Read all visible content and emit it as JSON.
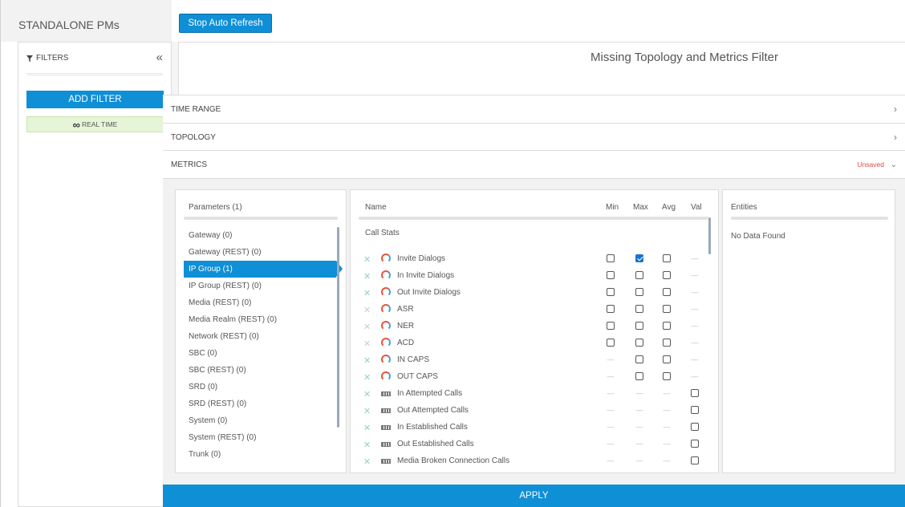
{
  "header": {
    "title": "STANDALONE PMs",
    "stop_refresh_label": "Stop Auto Refresh"
  },
  "filters": {
    "title": "FILTERS",
    "collapse_glyph": "«",
    "add_filter_label": "ADD FILTER",
    "realtime_label": "REAL TIME"
  },
  "main": {
    "missing_title": "Missing Topology and Metrics Filter",
    "sections": {
      "time_range": "TIME RANGE",
      "topology": "TOPOLOGY",
      "metrics": "METRICS",
      "unsaved": "Unsaved"
    },
    "apply_label": "APPLY"
  },
  "parameters": {
    "header": "Parameters (1)",
    "items": [
      "Gateway (0)",
      "Gateway (REST) (0)",
      "IP Group (1)",
      "IP Group (REST) (0)",
      "Media (REST) (0)",
      "Media Realm (REST) (0)",
      "Network (REST) (0)",
      "SBC (0)",
      "SBC (REST) (0)",
      "SRD (0)",
      "SRD (REST) (0)",
      "System (0)",
      "System (REST) (0)",
      "Trunk (0)"
    ],
    "selected": "IP Group (1)"
  },
  "metrics": {
    "columns": {
      "name": "Name",
      "min": "Min",
      "max": "Max",
      "avg": "Avg",
      "val": "Val"
    },
    "group": "Call Stats",
    "rows": [
      {
        "label": "Invite Dialogs",
        "icon": "gauge-icon",
        "min": "unchecked",
        "max": "checked",
        "avg": "unchecked",
        "val": "na"
      },
      {
        "label": "In Invite Dialogs",
        "icon": "gauge-icon",
        "min": "unchecked",
        "max": "unchecked",
        "avg": "unchecked",
        "val": "na"
      },
      {
        "label": "Out Invite Dialogs",
        "icon": "gauge-icon",
        "min": "unchecked",
        "max": "unchecked",
        "avg": "unchecked",
        "val": "na"
      },
      {
        "label": "ASR",
        "icon": "gauge-icon",
        "min": "unchecked",
        "max": "unchecked",
        "avg": "unchecked",
        "val": "na"
      },
      {
        "label": "NER",
        "icon": "gauge-icon",
        "min": "unchecked",
        "max": "unchecked",
        "avg": "unchecked",
        "val": "na"
      },
      {
        "label": "ACD",
        "icon": "gauge-icon",
        "min": "unchecked",
        "max": "unchecked",
        "avg": "unchecked",
        "val": "na"
      },
      {
        "label": "IN CAPS",
        "icon": "gauge-icon",
        "min": "na",
        "max": "unchecked",
        "avg": "unchecked",
        "val": "na"
      },
      {
        "label": "OUT CAPS",
        "icon": "gauge-icon",
        "min": "na",
        "max": "unchecked",
        "avg": "unchecked",
        "val": "na"
      },
      {
        "label": "In Attempted Calls",
        "icon": "counter-icon",
        "min": "na",
        "max": "na",
        "avg": "na",
        "val": "unchecked"
      },
      {
        "label": "Out Attempted Calls",
        "icon": "counter-icon",
        "min": "na",
        "max": "na",
        "avg": "na",
        "val": "unchecked"
      },
      {
        "label": "In Established Calls",
        "icon": "counter-icon",
        "min": "na",
        "max": "na",
        "avg": "na",
        "val": "unchecked"
      },
      {
        "label": "Out Established Calls",
        "icon": "counter-icon",
        "min": "na",
        "max": "na",
        "avg": "na",
        "val": "unchecked"
      },
      {
        "label": "Media Broken Connection Calls",
        "icon": "counter-icon",
        "min": "na",
        "max": "na",
        "avg": "na",
        "val": "unchecked"
      }
    ]
  },
  "entities": {
    "header": "Entities",
    "empty_text": "No Data Found"
  },
  "colors": {
    "accent": "#0f8fd6",
    "unsaved": "#e64545",
    "realtime_bg": "#e6f5d8"
  }
}
